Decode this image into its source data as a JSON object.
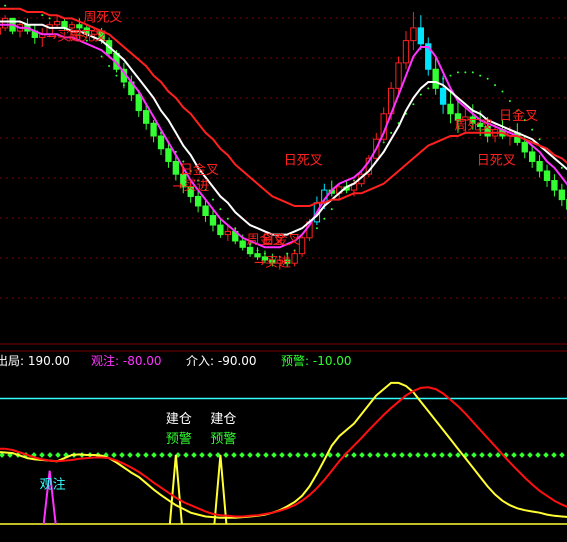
{
  "status_bar": {
    "items": [
      {
        "label": "出局:",
        "value": "190.00",
        "color": "#ffffff"
      },
      {
        "label": "观注:",
        "value": "-80.00",
        "color": "#ff33ff"
      },
      {
        "label": "介入:",
        "value": "-90.00",
        "color": "#ffffff"
      },
      {
        "label": "预警:",
        "value": "-10.00",
        "color": "#33ff33"
      }
    ]
  },
  "colors": {
    "background": "#000000",
    "up_candle": "#ff2020",
    "down_candle": "#33ff33",
    "highlight_candle": "#00e5ff",
    "ma_fast": "#ff33ff",
    "ma_mid": "#ffffff",
    "ma_slow": "#ff2020",
    "dots": "#33ff33",
    "grid": "#7a0000",
    "osc_yellow": "#ffff33",
    "osc_red": "#ff1010",
    "osc_green": "#33ff33",
    "osc_cyan": "#33ffff",
    "osc_magenta": "#ff33ff"
  },
  "chart_data": [
    {
      "type": "candlestick",
      "title": "",
      "xlabel": "",
      "ylabel": "",
      "price_range": [
        0,
        100
      ],
      "bars": [
        [
          93,
          97,
          91,
          95
        ],
        [
          95,
          99,
          94,
          98
        ],
        [
          98,
          98,
          93,
          94
        ],
        [
          94,
          97,
          92,
          96
        ],
        [
          96,
          98,
          93,
          94
        ],
        [
          94,
          96,
          90,
          92
        ],
        [
          92,
          95,
          89,
          93
        ],
        [
          93,
          97,
          92,
          96
        ],
        [
          96,
          99,
          95,
          97
        ],
        [
          97,
          98,
          94,
          95
        ],
        [
          95,
          97,
          93,
          96
        ],
        [
          96,
          98,
          94,
          95
        ],
        [
          95,
          96,
          92,
          93
        ],
        [
          93,
          95,
          91,
          94
        ],
        [
          94,
          95,
          90,
          91
        ],
        [
          91,
          92,
          86,
          87
        ],
        [
          87,
          88,
          81,
          82
        ],
        [
          82,
          84,
          76,
          78
        ],
        [
          78,
          80,
          72,
          74
        ],
        [
          74,
          75,
          67,
          69
        ],
        [
          69,
          71,
          63,
          65
        ],
        [
          65,
          66,
          59,
          61
        ],
        [
          61,
          63,
          55,
          57
        ],
        [
          57,
          59,
          51,
          53
        ],
        [
          53,
          55,
          47,
          49
        ],
        [
          49,
          51,
          43,
          45
        ],
        [
          45,
          47,
          40,
          42
        ],
        [
          42,
          44,
          37,
          39
        ],
        [
          39,
          41,
          34,
          36
        ],
        [
          36,
          38,
          31,
          33
        ],
        [
          33,
          35,
          29,
          30
        ],
        [
          30,
          33,
          28,
          31
        ],
        [
          31,
          32,
          27,
          28
        ],
        [
          28,
          30,
          25,
          26
        ],
        [
          26,
          28,
          23,
          24
        ],
        [
          24,
          26,
          22,
          23
        ],
        [
          23,
          25,
          21,
          22
        ],
        [
          22,
          24,
          20,
          21
        ],
        [
          21,
          23,
          19,
          22
        ],
        [
          22,
          24,
          20,
          21
        ],
        [
          21,
          25,
          20,
          24
        ],
        [
          24,
          30,
          23,
          29
        ],
        [
          29,
          35,
          28,
          34
        ],
        [
          34,
          42,
          33,
          40
        ],
        [
          40,
          46,
          38,
          44
        ],
        [
          44,
          47,
          42,
          43
        ],
        [
          43,
          46,
          41,
          45
        ],
        [
          45,
          47,
          43,
          44
        ],
        [
          44,
          47,
          42,
          46
        ],
        [
          46,
          50,
          45,
          49
        ],
        [
          49,
          55,
          48,
          54
        ],
        [
          54,
          62,
          53,
          60
        ],
        [
          60,
          70,
          59,
          68
        ],
        [
          68,
          78,
          66,
          76
        ],
        [
          76,
          86,
          74,
          84
        ],
        [
          84,
          94,
          82,
          91
        ],
        [
          91,
          100,
          88,
          95
        ],
        [
          95,
          99,
          88,
          90
        ],
        [
          90,
          92,
          80,
          82
        ],
        [
          82,
          86,
          74,
          76
        ],
        [
          76,
          80,
          68,
          71
        ],
        [
          71,
          75,
          65,
          68
        ],
        [
          68,
          72,
          62,
          66
        ],
        [
          66,
          70,
          62,
          67
        ],
        [
          67,
          71,
          63,
          65
        ],
        [
          65,
          69,
          61,
          64
        ],
        [
          64,
          67,
          59,
          61
        ],
        [
          61,
          65,
          59,
          63
        ],
        [
          63,
          66,
          60,
          61
        ],
        [
          61,
          64,
          58,
          62
        ],
        [
          62,
          65,
          58,
          59
        ],
        [
          59,
          61,
          54,
          56
        ],
        [
          56,
          58,
          51,
          53
        ],
        [
          53,
          55,
          48,
          50
        ],
        [
          50,
          52,
          45,
          47
        ],
        [
          47,
          49,
          42,
          44
        ],
        [
          44,
          46,
          39,
          41
        ],
        [
          41,
          43,
          36,
          38
        ]
      ],
      "series": [
        {
          "name": "",
          "color": "#ff33ff",
          "values": [
            96,
            96,
            96,
            95,
            95,
            94,
            93,
            93,
            93,
            92,
            92,
            91,
            90,
            89,
            88,
            86,
            84,
            81,
            78,
            75,
            71,
            67,
            63,
            59,
            55,
            51,
            47,
            44,
            41,
            38,
            35,
            33,
            31,
            29,
            28,
            27,
            26,
            26,
            26,
            27,
            28,
            30,
            33,
            37,
            41,
            44,
            46,
            47,
            48,
            50,
            53,
            57,
            62,
            68,
            74,
            80,
            86,
            89,
            89,
            86,
            81,
            76,
            72,
            70,
            68,
            66,
            65,
            64,
            63,
            62,
            61,
            60,
            58,
            56,
            53,
            51,
            48,
            45
          ]
        },
        {
          "name": "",
          "color": "#ffffff",
          "values": [
            97,
            97,
            97,
            97,
            96,
            96,
            96,
            95,
            95,
            95,
            94,
            94,
            93,
            92,
            91,
            89,
            87,
            85,
            82,
            79,
            76,
            73,
            69,
            66,
            62,
            58,
            55,
            51,
            48,
            45,
            42,
            40,
            37,
            35,
            33,
            32,
            31,
            30,
            30,
            30,
            31,
            32,
            34,
            36,
            39,
            41,
            43,
            45,
            46,
            48,
            50,
            53,
            56,
            60,
            64,
            69,
            73,
            76,
            78,
            78,
            77,
            75,
            73,
            71,
            69,
            68,
            66,
            65,
            64,
            63,
            62,
            61,
            60,
            58,
            56,
            54,
            52,
            50
          ]
        },
        {
          "name": "",
          "color": "#ff2020",
          "values": [
            101,
            101,
            101,
            101,
            100,
            100,
            100,
            99,
            99,
            98,
            98,
            97,
            96,
            95,
            94,
            93,
            91,
            89,
            87,
            85,
            83,
            80,
            78,
            75,
            73,
            70,
            68,
            65,
            62,
            60,
            57,
            55,
            52,
            50,
            48,
            46,
            44,
            42,
            41,
            40,
            39,
            39,
            39,
            40,
            40,
            41,
            41,
            42,
            43,
            43,
            44,
            45,
            46,
            48,
            50,
            52,
            54,
            56,
            58,
            59,
            60,
            61,
            61,
            62,
            62,
            62,
            62,
            62,
            62,
            61,
            61,
            60,
            59,
            58,
            57,
            55,
            54,
            52
          ]
        },
        {
          "name": "",
          "color": "#33ff33",
          "values": [
            102,
            102,
            101,
            101,
            100,
            100,
            99,
            98,
            97,
            96,
            95,
            93,
            91,
            89,
            86,
            83,
            80,
            77,
            74,
            71,
            68,
            65,
            62,
            59,
            56,
            53,
            50,
            47,
            44,
            41,
            38,
            35,
            32,
            29,
            27,
            25,
            24,
            23,
            23,
            24,
            25,
            27,
            29,
            32,
            35,
            38,
            41,
            44,
            47,
            50,
            53,
            56,
            59,
            62,
            65,
            68,
            71,
            74,
            76,
            78,
            79,
            80,
            81,
            81,
            81,
            80,
            79,
            77,
            75,
            72,
            69,
            66,
            63,
            60,
            57,
            54,
            51,
            48
          ]
        }
      ],
      "annotations": [
        {
          "text": "买进",
          "bar": 6,
          "price": 91,
          "color": "#ff2020",
          "arrow": true
        },
        {
          "text": "周死叉",
          "bar": 9,
          "price": 91,
          "color": "#ff2020"
        },
        {
          "text": "周死叉",
          "bar": 11,
          "price": 97,
          "color": "#ff2020"
        },
        {
          "text": "日金叉",
          "bar": 24,
          "price": 49,
          "color": "#ff2020"
        },
        {
          "text": "买进",
          "bar": 23,
          "price": 44,
          "color": "#ff2020",
          "arrow": true
        },
        {
          "text": "周金叉",
          "bar": 33,
          "price": 27,
          "color": "#ff2020"
        },
        {
          "text": "日金叉",
          "bar": 35,
          "price": 27,
          "color": "#ff2020"
        },
        {
          "text": "买进",
          "bar": 34,
          "price": 20,
          "color": "#ff2020",
          "arrow": true
        },
        {
          "text": "日死叉",
          "bar": 38,
          "price": 52,
          "color": "#ff2020"
        },
        {
          "text": "周死叉",
          "bar": 61,
          "price": 63,
          "color": "#ff2020"
        },
        {
          "text": "日金叉",
          "bar": 67,
          "price": 66,
          "color": "#ff2020"
        },
        {
          "text": "日死叉",
          "bar": 64,
          "price": 52,
          "color": "#ff2020"
        }
      ]
    },
    {
      "type": "line",
      "title": "",
      "xlabel": "",
      "ylabel": "",
      "ylim": [
        -10,
        210
      ],
      "reference_lines": [
        {
          "value": 190,
          "color": "#33ffff"
        },
        {
          "value": -10,
          "color": "#ffff33"
        },
        {
          "value": -90,
          "color": "#ff33ff"
        },
        {
          "value": 100,
          "color": "#33ff33",
          "dotted": true
        }
      ],
      "series": [
        {
          "name": "",
          "color": "#ffff33",
          "values": [
            105,
            104,
            103,
            99,
            95,
            93,
            92,
            91,
            90,
            95,
            100,
            101,
            100,
            100,
            99,
            95,
            88,
            80,
            72,
            65,
            55,
            45,
            36,
            28,
            20,
            14,
            8,
            5,
            2,
            1,
            0,
            0,
            0,
            1,
            2,
            3,
            5,
            8,
            12,
            18,
            25,
            35,
            50,
            70,
            92,
            115,
            130,
            140,
            150,
            165,
            180,
            195,
            205,
            215,
            215,
            210,
            200,
            185,
            170,
            155,
            140,
            125,
            110,
            95,
            80,
            65,
            50,
            37,
            27,
            20,
            15,
            12,
            10,
            8,
            5,
            3,
            2,
            1
          ]
        },
        {
          "name": "",
          "color": "#ff1010",
          "values": [
            110,
            110,
            108,
            104,
            100,
            96,
            93,
            91,
            90,
            91,
            92,
            94,
            95,
            96,
            96,
            95,
            91,
            86,
            80,
            73,
            65,
            56,
            48,
            40,
            32,
            25,
            20,
            15,
            10,
            6,
            4,
            3,
            2,
            2,
            3,
            4,
            6,
            8,
            11,
            15,
            20,
            27,
            36,
            47,
            60,
            75,
            90,
            103,
            115,
            127,
            140,
            152,
            164,
            175,
            185,
            195,
            202,
            207,
            208,
            205,
            198,
            188,
            178,
            166,
            153,
            140,
            127,
            114,
            101,
            88,
            76,
            64,
            53,
            43,
            35,
            27,
            21,
            16
          ]
        }
      ],
      "spikes": [
        {
          "bar": 7,
          "value": 75,
          "color": "#ff33ff",
          "label": "观注"
        },
        {
          "bar": 24,
          "value": 100,
          "color": "#ffff33",
          "label": "建仓",
          "sublabel": "预警"
        },
        {
          "bar": 30,
          "value": 100,
          "color": "#ffff33",
          "label": "建仓",
          "sublabel": "预警"
        }
      ]
    }
  ]
}
